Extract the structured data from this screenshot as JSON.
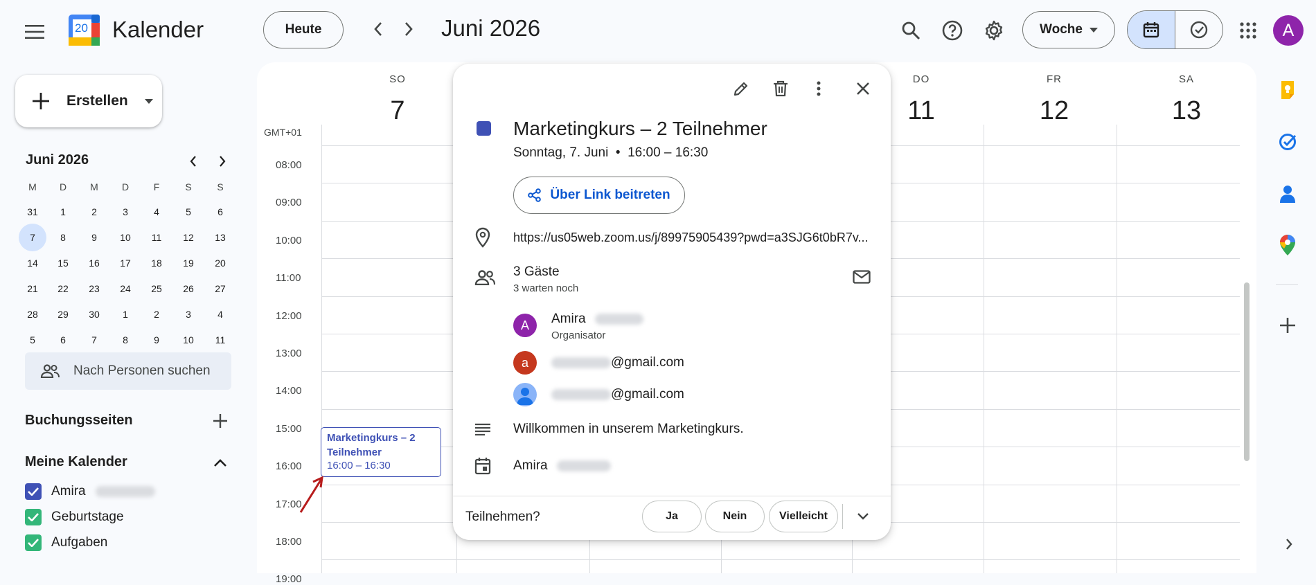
{
  "header": {
    "app_name": "Kalender",
    "logo_day": "20",
    "today_label": "Heute",
    "month_title": "Juni 2026",
    "view_label": "Woche",
    "avatar_letter": "A"
  },
  "sidebar": {
    "create_label": "Erstellen",
    "mini_month": "Juni 2026",
    "weekday_heads": [
      "M",
      "D",
      "M",
      "D",
      "F",
      "S",
      "S"
    ],
    "weeks": [
      [
        "31",
        "1",
        "2",
        "3",
        "4",
        "5",
        "6"
      ],
      [
        "7",
        "8",
        "9",
        "10",
        "11",
        "12",
        "13"
      ],
      [
        "14",
        "15",
        "16",
        "17",
        "18",
        "19",
        "20"
      ],
      [
        "21",
        "22",
        "23",
        "24",
        "25",
        "26",
        "27"
      ],
      [
        "28",
        "29",
        "30",
        "1",
        "2",
        "3",
        "4"
      ],
      [
        "5",
        "6",
        "7",
        "8",
        "9",
        "10",
        "11"
      ]
    ],
    "people_search": "Nach Personen suchen",
    "booking_pages": "Buchungsseiten",
    "my_calendars": "Meine Kalender",
    "calendars": [
      {
        "name": "Amira",
        "color": "#3f51b5"
      },
      {
        "name": "Geburtstage",
        "color": "#33b679"
      },
      {
        "name": "Aufgaben",
        "color": "#33b679"
      }
    ]
  },
  "grid": {
    "timezone": "GMT+01",
    "days": [
      {
        "dow": "SO",
        "num": "7"
      },
      {
        "dow": "DO",
        "num": "11"
      },
      {
        "dow": "FR",
        "num": "12"
      },
      {
        "dow": "SA",
        "num": "13"
      }
    ],
    "times": [
      "08:00",
      "09:00",
      "10:00",
      "11:00",
      "12:00",
      "13:00",
      "14:00",
      "15:00",
      "16:00",
      "17:00",
      "18:00",
      "19:00"
    ]
  },
  "event": {
    "title": "Marketingkurs – 2 Teilnehmer",
    "time": "16:00 – 16:30",
    "color": "#3f51b5"
  },
  "popup": {
    "title": "Marketingkurs – 2 Teilnehmer",
    "subtitle": "Sonntag, 7. Juni  •  16:00 – 16:30",
    "join_label": "Über Link beitreten",
    "location": "https://us05web.zoom.us/j/89975905439?pwd=a3SJG6t0bR7v...",
    "guests_count": "3 Gäste",
    "guests_pending": "3 warten noch",
    "guests": [
      {
        "initial": "A",
        "name": "Amira",
        "role": "Organisator",
        "color": "#8e24aa"
      },
      {
        "initial": "a",
        "email_suffix": "@gmail.com",
        "color": "#c5381e"
      },
      {
        "initial": "",
        "email_suffix": "@gmail.com",
        "color": "#8ab4f8"
      }
    ],
    "description": "Willkommen in unserem Marketingkurs.",
    "calendar_owner": "Amira",
    "rsvp_question": "Teilnehmen?",
    "rsvp_yes": "Ja",
    "rsvp_no": "Nein",
    "rsvp_maybe": "Vielleicht"
  }
}
